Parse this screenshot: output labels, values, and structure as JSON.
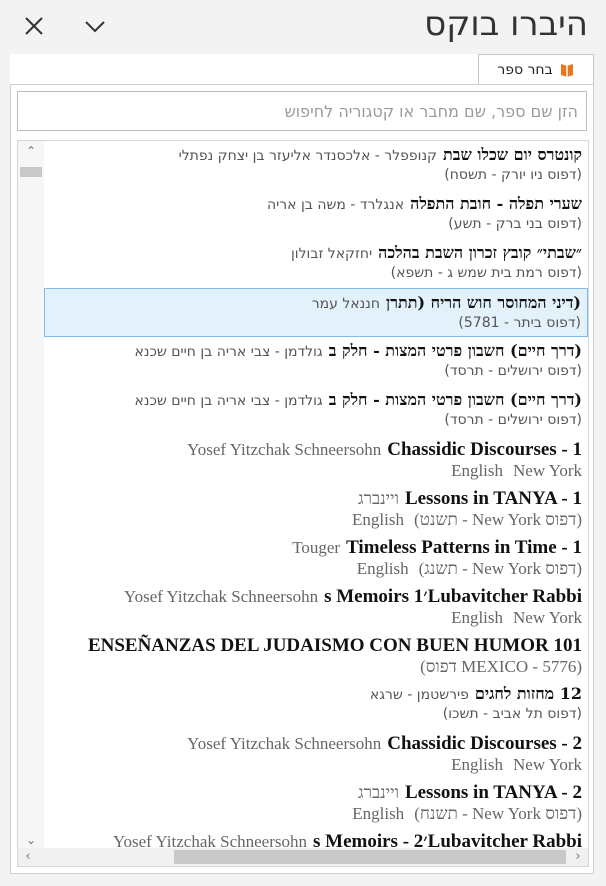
{
  "header": {
    "title": "היברו בוקס"
  },
  "tab": {
    "label": "בחר ספר",
    "icon": "book-icon"
  },
  "search": {
    "placeholder": "הזן שם ספר, שם מחבר או קטגוריה לחיפוש",
    "value": ""
  },
  "books": [
    {
      "title": "קונטרס יום שכלו שבת",
      "author": "קנופפלר - אלכסנדר אליעזר בן יצחק נפתלי",
      "meta": [
        "(דפוס ניו יורק - תשסח)"
      ],
      "lang": "he"
    },
    {
      "title": "שערי תפלה - חובת התפלה",
      "author": "אנגלרד - משה בן אריה",
      "meta": [
        "(דפוס בני ברק - תשע)"
      ],
      "lang": "he"
    },
    {
      "title": "״שבתי״ קובץ זכרון השבת בהלכה",
      "author": "יחזקאל זבולון",
      "meta": [
        "(דפוס רמת בית שמש ג - תשפא)"
      ],
      "lang": "he"
    },
    {
      "title": "(דיני המחוסר חוש הריח (תתרן",
      "author": "חננאל עמר",
      "meta": [
        "(דפוס ביתר - 5781)"
      ],
      "lang": "he",
      "selected": true
    },
    {
      "title": "(דרך חיים) חשבון פרטי המצות - חלק ב",
      "author": "גולדמן - צבי אריה בן חיים שכנא",
      "meta": [
        "(דפוס ירושלים - תרסד)"
      ],
      "lang": "he"
    },
    {
      "title": "(דרך חיים) חשבון פרטי המצות - חלק ב",
      "author": "גולדמן - צבי אריה בן חיים שכנא",
      "meta": [
        "(דפוס ירושלים - תרסד)"
      ],
      "lang": "he"
    },
    {
      "title": "Chassidic Discourses - 1",
      "author": "Yosef Yitzchak Schneersohn",
      "meta": [
        "New York",
        "English"
      ],
      "lang": "en"
    },
    {
      "title": "Lessons in TANYA - 1",
      "author": "ויינברג",
      "meta": [
        "(דפוס New York - תשנט)",
        "English"
      ],
      "lang": "en"
    },
    {
      "title": "Timeless Patterns in Time - 1",
      "author": "Touger",
      "meta": [
        "(דפוס New York - תשנג)",
        "English"
      ],
      "lang": "en"
    },
    {
      "title": "Lubavitcher Rabbi׳s Memoirs 1",
      "author": "Yosef Yitzchak Schneersohn",
      "meta": [
        "New York",
        "English"
      ],
      "lang": "en"
    },
    {
      "title": "ENSEÑANZAS DEL JUDAISMO CON BUEN HUMOR 101",
      "author": "",
      "meta": [
        "(MEXICO - 5776 דפוס)"
      ],
      "lang": "en"
    },
    {
      "title": "12 מחזות לחגים",
      "author": "פירשטמן - שרגא",
      "meta": [
        "(דפוס תל אביב - תשכו)"
      ],
      "lang": "he"
    },
    {
      "title": "Chassidic Discourses - 2",
      "author": "Yosef Yitzchak Schneersohn",
      "meta": [
        "New York",
        "English"
      ],
      "lang": "en"
    },
    {
      "title": "Lessons in TANYA - 2",
      "author": "ויינברג",
      "meta": [
        "(דפוס New York - תשנח)",
        "English"
      ],
      "lang": "en"
    },
    {
      "title": "Lubavitcher Rabbi׳s Memoirs - 2",
      "author": "Yosef Yitzchak Schneersohn",
      "meta": [],
      "lang": "en"
    }
  ],
  "colors": {
    "selected_bg": "#e3f1fb",
    "selected_border": "#7fbbe6",
    "tab_icon": "#e8771a"
  }
}
